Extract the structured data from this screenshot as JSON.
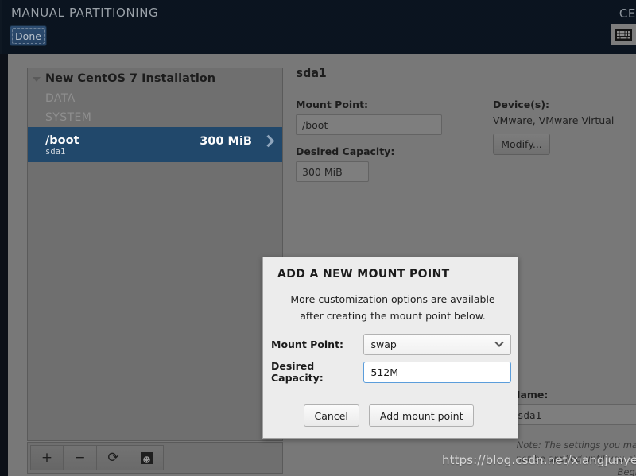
{
  "header": {
    "title": "MANUAL PARTITIONING",
    "done_label": "Done",
    "brand": "CE",
    "keyboard_icon": "keyboard-layout-icon"
  },
  "device_panel": {
    "root_label": "New CentOS 7 Installation",
    "sections": [
      {
        "label": "DATA"
      },
      {
        "label": "SYSTEM"
      }
    ],
    "mount_points": [
      {
        "name": "/boot",
        "device": "sda1",
        "size": "300 MiB",
        "selected": true,
        "chevron_icon": "chevron-right-icon"
      }
    ],
    "toolbar": [
      {
        "name": "add-mount-point-button",
        "glyph": "+",
        "icon": "plus-icon"
      },
      {
        "name": "remove-mount-point-button",
        "glyph": "−",
        "icon": "minus-icon"
      },
      {
        "name": "refresh-button",
        "glyph": "⟳",
        "icon": "refresh-icon"
      },
      {
        "name": "storage-summary-button",
        "glyph": "",
        "icon": "disk-summary-icon"
      }
    ]
  },
  "detail": {
    "title": "sda1",
    "mount_point_label": "Mount Point:",
    "mount_point_value": "/boot",
    "desired_capacity_label": "Desired Capacity:",
    "desired_capacity_value": "300 MiB",
    "devices_label": "Device(s):",
    "devices_value": "VMware, VMware Virtual",
    "modify_label": "Modify...",
    "name_label": "Name:",
    "name_value": "sda1",
    "note_line1": "Note:  The settings you ma",
    "note_line2": "not be applied until you cli",
    "note_line3": "Begi"
  },
  "modal": {
    "title": "ADD A NEW MOUNT POINT",
    "description_line1": "More customization options are available",
    "description_line2": "after creating the mount point below.",
    "mount_point_label": "Mount Point:",
    "mount_point_value": "swap",
    "mount_point_options": [
      "swap"
    ],
    "dropdown_icon": "chevron-down-icon",
    "desired_capacity_label": "Desired Capacity:",
    "desired_capacity_value": "512M",
    "cancel_label": "Cancel",
    "confirm_label": "Add mount point"
  },
  "watermark": {
    "text": "https://blog.csdn.net/xiangjunyes"
  },
  "colors": {
    "header_bg": "#0b1420",
    "body_bg": "#787878",
    "selection_blue": "#21486b",
    "modal_bg": "#ececec",
    "focus_border": "#5b9ddb"
  }
}
